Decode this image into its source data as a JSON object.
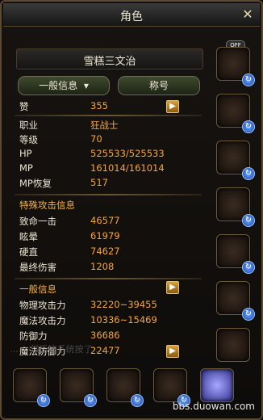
{
  "window": {
    "title": "角色",
    "close_icon": "close-icon"
  },
  "character": {
    "name": "雪糕三文治"
  },
  "header_buttons": {
    "general_info": "一般信息",
    "title_button": "称号"
  },
  "stats_main": [
    {
      "key": "赞",
      "value": "355"
    },
    {
      "key": "职业",
      "value": "狂战士"
    },
    {
      "key": "等级",
      "value": "70"
    },
    {
      "key": "HP",
      "value": "525533/525533"
    },
    {
      "key": "MP",
      "value": "161014/161014"
    },
    {
      "key": "MP恢复",
      "value": "517"
    }
  ],
  "special_attack": {
    "title": "特殊攻击信息",
    "rows": [
      {
        "key": "致命一击",
        "value": "46577"
      },
      {
        "key": "眩晕",
        "value": "61979"
      },
      {
        "key": "硬直",
        "value": "74627"
      },
      {
        "key": "最终伤害",
        "value": "1208"
      }
    ]
  },
  "general_info": {
    "title": "一般信息",
    "rows": [
      {
        "key": "物理攻击力",
        "value": "32220~39455"
      },
      {
        "key": "魔法攻击力",
        "value": "10336~15469"
      },
      {
        "key": "防御力",
        "value": "36686"
      },
      {
        "key": "魔法防御力",
        "value": "22477"
      }
    ]
  },
  "equip_right": {
    "off_badge": "OFF"
  },
  "ticker_text": "…… 然后被系统按了 ……",
  "watermark": "bbs.duowan.com"
}
